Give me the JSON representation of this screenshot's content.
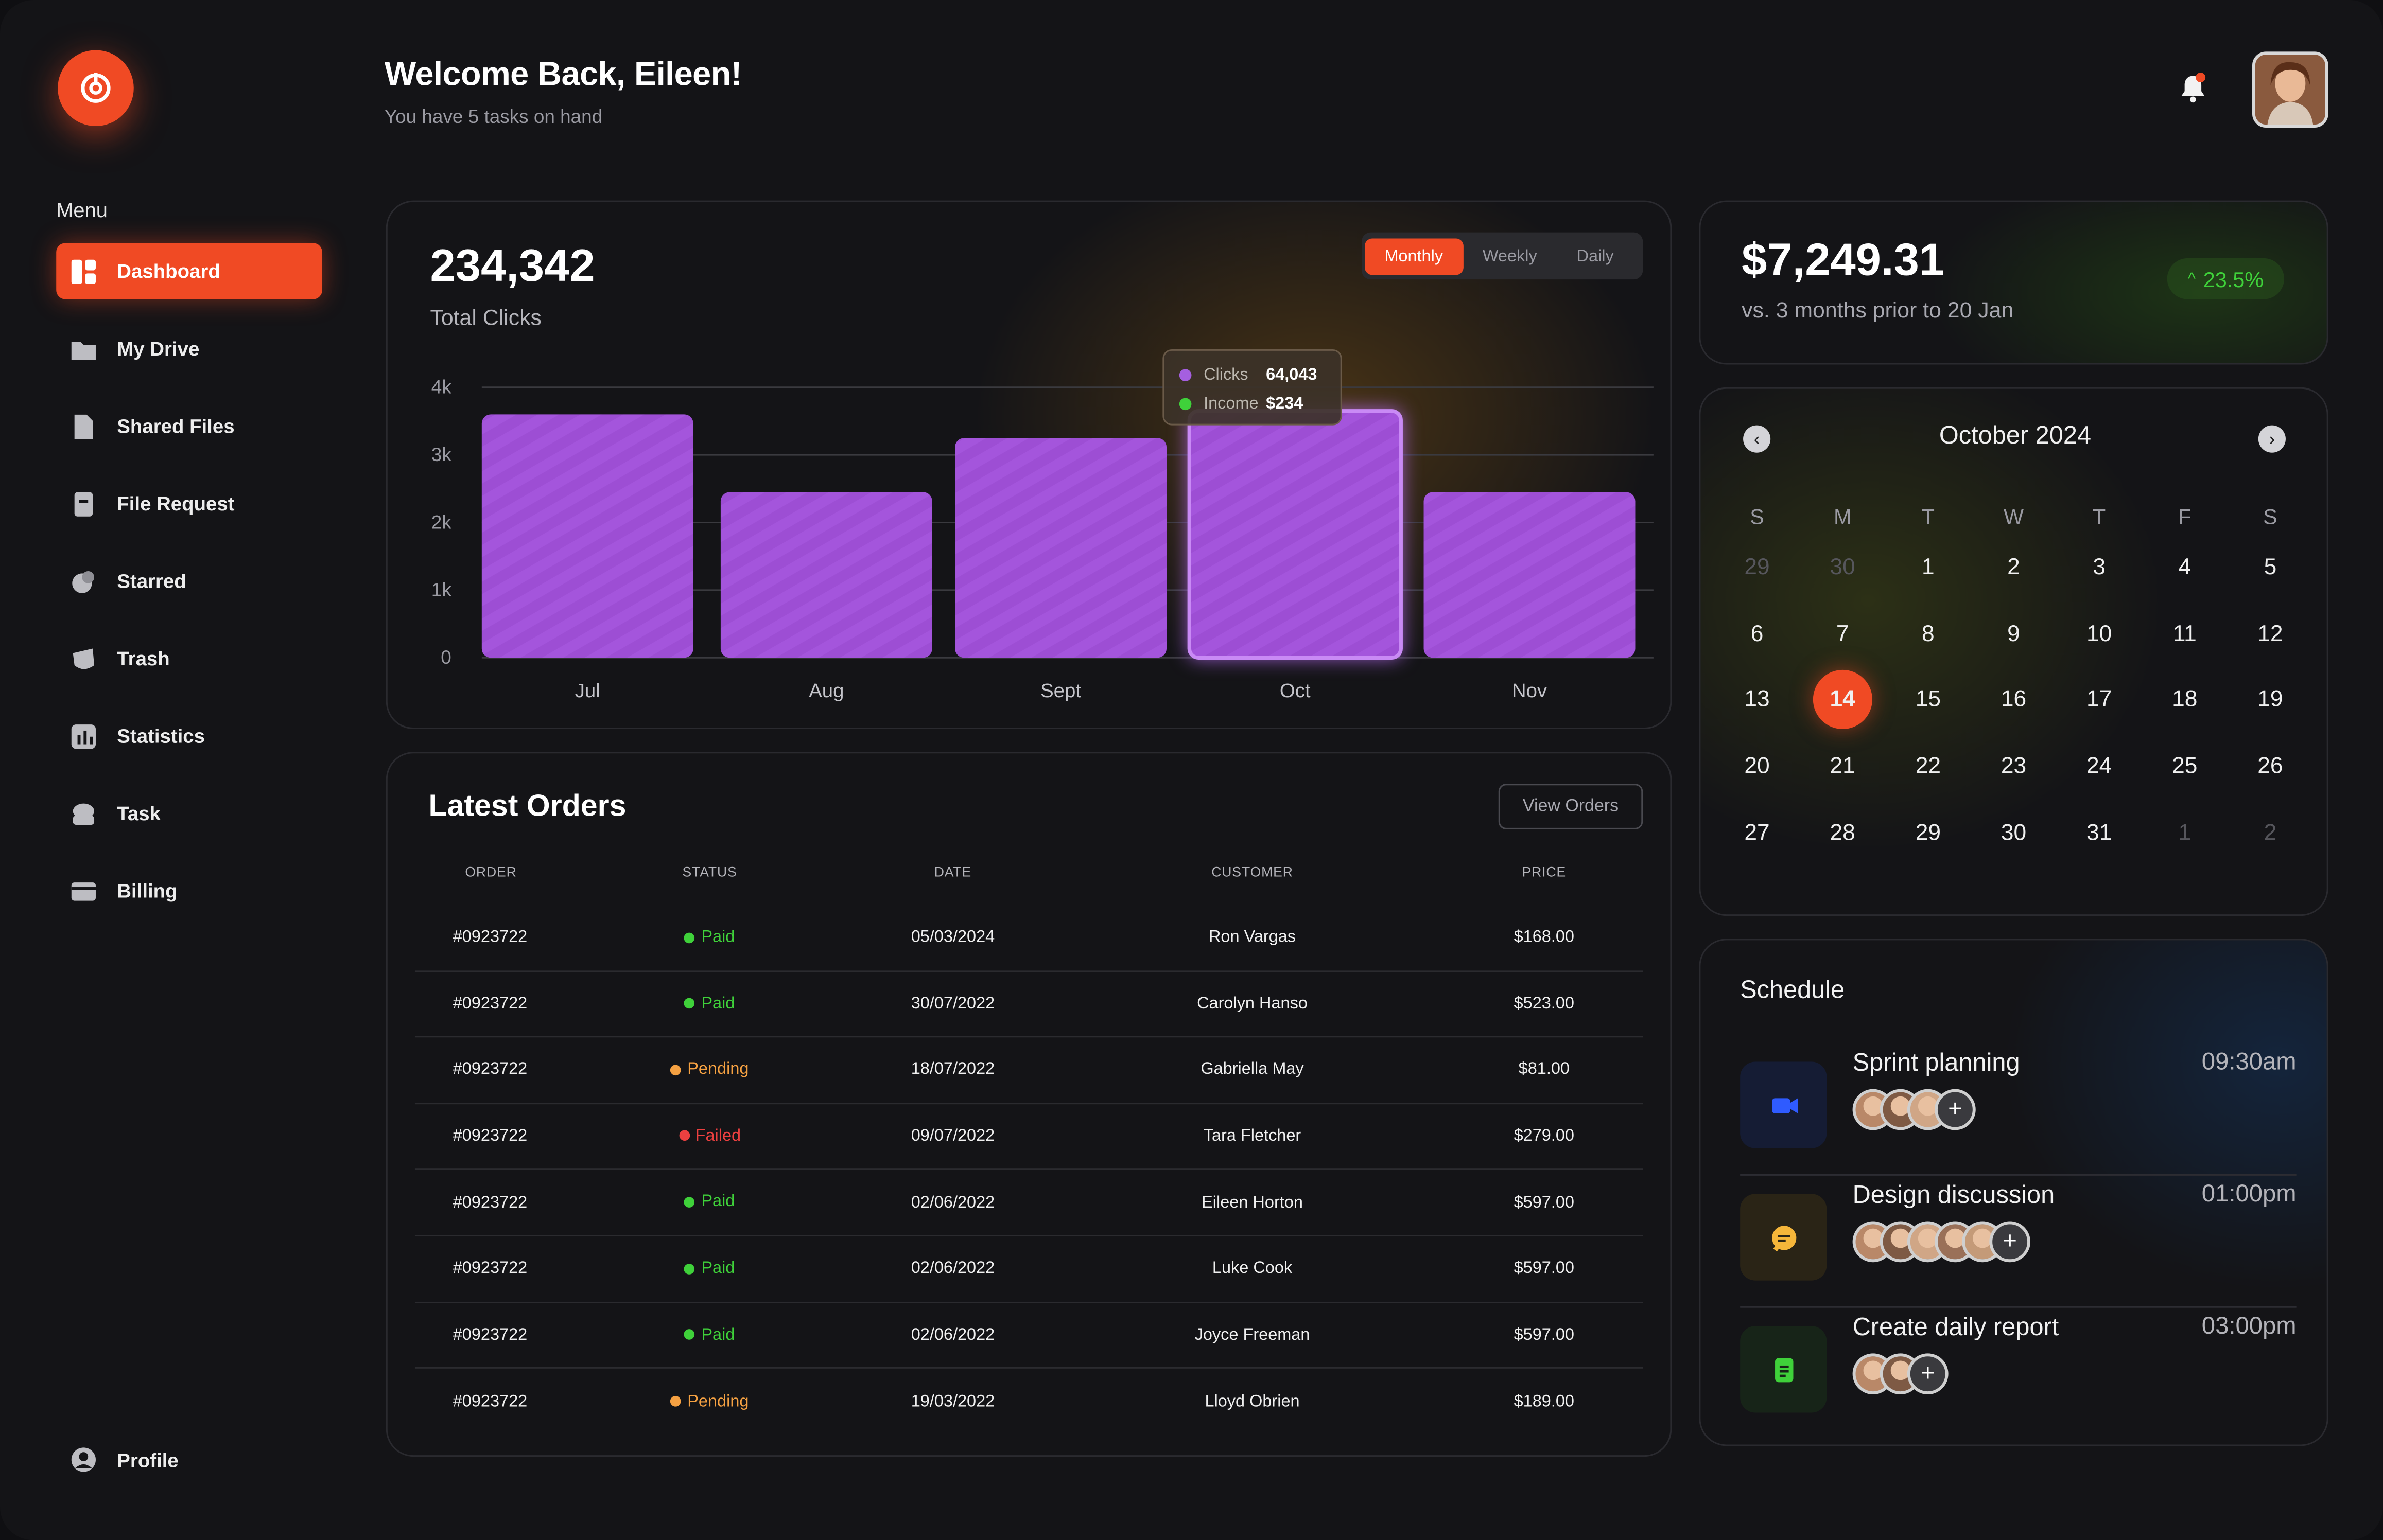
{
  "header": {
    "greeting": "Welcome Back, Eileen!",
    "subtitle": "You have 5 tasks on hand"
  },
  "sidebar": {
    "menu_label": "Menu",
    "items": [
      {
        "label": "Dashboard",
        "icon": "dashboard-icon",
        "active": true
      },
      {
        "label": "My Drive",
        "icon": "folder-icon"
      },
      {
        "label": "Shared Files",
        "icon": "shared-file-icon"
      },
      {
        "label": "File Request",
        "icon": "file-request-icon"
      },
      {
        "label": "Starred",
        "icon": "star-icon"
      },
      {
        "label": "Trash",
        "icon": "trash-icon"
      },
      {
        "label": "Statistics",
        "icon": "statistics-icon"
      },
      {
        "label": "Task",
        "icon": "task-icon"
      },
      {
        "label": "Billing",
        "icon": "billing-icon"
      }
    ],
    "profile_label": "Profile"
  },
  "clicks": {
    "total": "234,342",
    "label": "Total Clicks",
    "tabs": [
      "Monthly",
      "Weekly",
      "Daily"
    ],
    "active_tab": "Monthly",
    "tooltip": {
      "clicks_label": "Clicks",
      "clicks_value": "64,043",
      "income_label": "Income",
      "income_value": "$234"
    }
  },
  "chart_data": {
    "type": "bar",
    "categories": [
      "Jul",
      "Aug",
      "Sept",
      "Oct",
      "Nov"
    ],
    "values": [
      3600,
      2450,
      3250,
      3650,
      2450
    ],
    "highlighted": "Oct",
    "y_ticks": [
      "0",
      "1k",
      "2k",
      "3k",
      "4k"
    ],
    "ylim": [
      0,
      4000
    ],
    "bar_color": "#9d4ed4"
  },
  "revenue": {
    "amount": "$7,249.31",
    "subtitle": "vs. 3 months prior to 20 Jan",
    "change": "23.5%"
  },
  "calendar": {
    "title": "October 2024",
    "weekdays": [
      "S",
      "M",
      "T",
      "W",
      "T",
      "F",
      "S"
    ],
    "weeks": [
      [
        "29",
        "30",
        "1",
        "2",
        "3",
        "4",
        "5"
      ],
      [
        "6",
        "7",
        "8",
        "9",
        "10",
        "11",
        "12"
      ],
      [
        "13",
        "14",
        "15",
        "16",
        "17",
        "18",
        "19"
      ],
      [
        "20",
        "21",
        "22",
        "23",
        "24",
        "25",
        "26"
      ],
      [
        "27",
        "28",
        "29",
        "30",
        "31",
        "1",
        "2"
      ]
    ],
    "today": "14"
  },
  "orders": {
    "title": "Latest Orders",
    "view_label": "View Orders",
    "columns": [
      "ORDER",
      "STATUS",
      "DATE",
      "CUSTOMER",
      "PRICE"
    ],
    "rows": [
      {
        "order": "#0923722",
        "status": "Paid",
        "date": "05/03/2024",
        "customer": "Ron Vargas",
        "price": "$168.00"
      },
      {
        "order": "#0923722",
        "status": "Paid",
        "date": "30/07/2022",
        "customer": "Carolyn Hanso",
        "price": "$523.00"
      },
      {
        "order": "#0923722",
        "status": "Pending",
        "date": "18/07/2022",
        "customer": "Gabriella May",
        "price": "$81.00"
      },
      {
        "order": "#0923722",
        "status": "Failed",
        "date": "09/07/2022",
        "customer": "Tara Fletcher",
        "price": "$279.00"
      },
      {
        "order": "#0923722",
        "status": "Paid",
        "date": "02/06/2022",
        "customer": "Eileen Horton",
        "price": "$597.00"
      },
      {
        "order": "#0923722",
        "status": "Paid",
        "date": "02/06/2022",
        "customer": "Luke Cook",
        "price": "$597.00"
      },
      {
        "order": "#0923722",
        "status": "Paid",
        "date": "02/06/2022",
        "customer": "Joyce Freeman",
        "price": "$597.00"
      },
      {
        "order": "#0923722",
        "status": "Pending",
        "date": "19/03/2022",
        "customer": "Lloyd Obrien",
        "price": "$189.00"
      }
    ]
  },
  "schedule": {
    "title": "Schedule",
    "events": [
      {
        "name": "Sprint planning",
        "time": "09:30am",
        "icon": "video-icon",
        "attendees": 3
      },
      {
        "name": "Design discussion",
        "time": "01:00pm",
        "icon": "chat-icon",
        "attendees": 5
      },
      {
        "name": "Create daily report",
        "time": "03:00pm",
        "icon": "document-icon",
        "attendees": 2
      }
    ]
  },
  "colors": {
    "accent": "#f04a24",
    "bar": "#9d4ed4",
    "paid": "#3fd13a",
    "pending": "#f5a142",
    "failed": "#ec4040"
  }
}
